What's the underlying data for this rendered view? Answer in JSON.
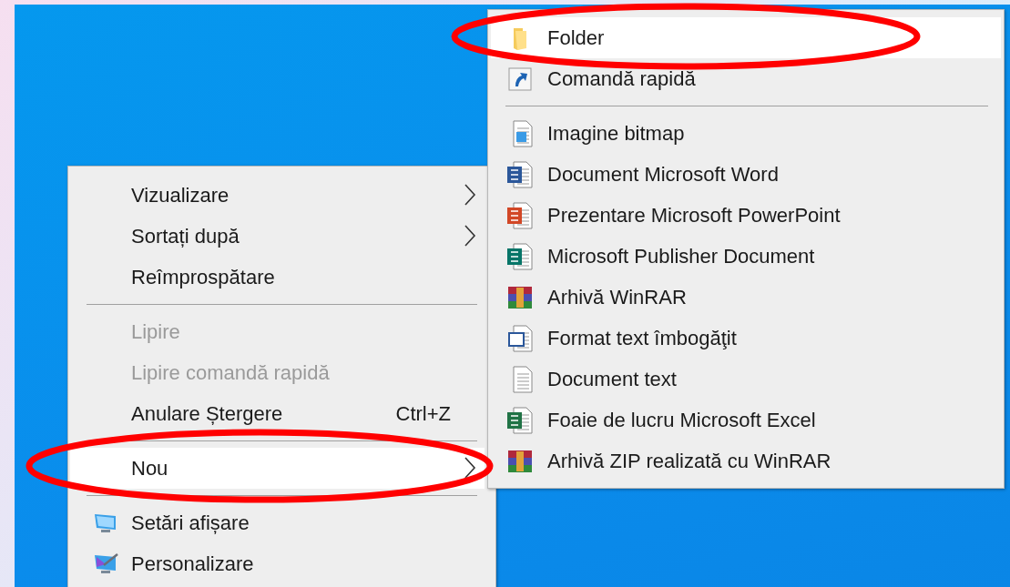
{
  "context_menu": {
    "items": [
      {
        "kind": "item",
        "label": "Vizualizare",
        "submenu": true,
        "disabled": false,
        "selected": false,
        "circled": false
      },
      {
        "kind": "item",
        "label": "Sortați după",
        "submenu": true,
        "disabled": false,
        "selected": false,
        "circled": false
      },
      {
        "kind": "item",
        "label": "Reîmprospătare",
        "submenu": false,
        "disabled": false,
        "selected": false,
        "circled": false
      },
      {
        "kind": "separator"
      },
      {
        "kind": "item",
        "label": "Lipire",
        "submenu": false,
        "disabled": true,
        "selected": false,
        "circled": false
      },
      {
        "kind": "item",
        "label": "Lipire comandă rapidă",
        "submenu": false,
        "disabled": true,
        "selected": false,
        "circled": false
      },
      {
        "kind": "item",
        "label": "Anulare Ștergere",
        "shortcut": "Ctrl+Z",
        "submenu": false,
        "disabled": false,
        "selected": false,
        "circled": false
      },
      {
        "kind": "separator"
      },
      {
        "kind": "item",
        "label": "Nou",
        "submenu": true,
        "disabled": false,
        "selected": true,
        "circled": true
      },
      {
        "kind": "separator"
      },
      {
        "kind": "display",
        "label": "Setări afișare",
        "submenu": false,
        "disabled": false,
        "selected": false,
        "circled": false
      },
      {
        "kind": "personalize",
        "label": "Personalizare",
        "submenu": false,
        "disabled": false,
        "selected": false,
        "circled": false
      }
    ]
  },
  "new_submenu": {
    "items": [
      {
        "kind": "folder",
        "label": "Folder",
        "selected": true,
        "circled": true
      },
      {
        "kind": "shortcut",
        "label": "Comandă rapidă",
        "selected": false,
        "circled": false
      },
      {
        "kind": "separator"
      },
      {
        "kind": "bitmap",
        "label": "Imagine bitmap",
        "selected": false,
        "circled": false
      },
      {
        "kind": "word",
        "label": "Document Microsoft Word",
        "selected": false,
        "circled": false
      },
      {
        "kind": "powerpoint",
        "label": "Prezentare Microsoft PowerPoint",
        "selected": false,
        "circled": false
      },
      {
        "kind": "publisher",
        "label": "Microsoft Publisher Document",
        "selected": false,
        "circled": false
      },
      {
        "kind": "winrar",
        "label": "Arhivă WinRAR",
        "selected": false,
        "circled": false
      },
      {
        "kind": "rtf",
        "label": "Format text îmbogăţit",
        "selected": false,
        "circled": false
      },
      {
        "kind": "text",
        "label": "Document text",
        "selected": false,
        "circled": false
      },
      {
        "kind": "excel",
        "label": "Foaie de lucru Microsoft Excel",
        "selected": false,
        "circled": false
      },
      {
        "kind": "zip",
        "label": "Arhivă ZIP realizată cu WinRAR",
        "selected": false,
        "circled": false
      }
    ]
  }
}
